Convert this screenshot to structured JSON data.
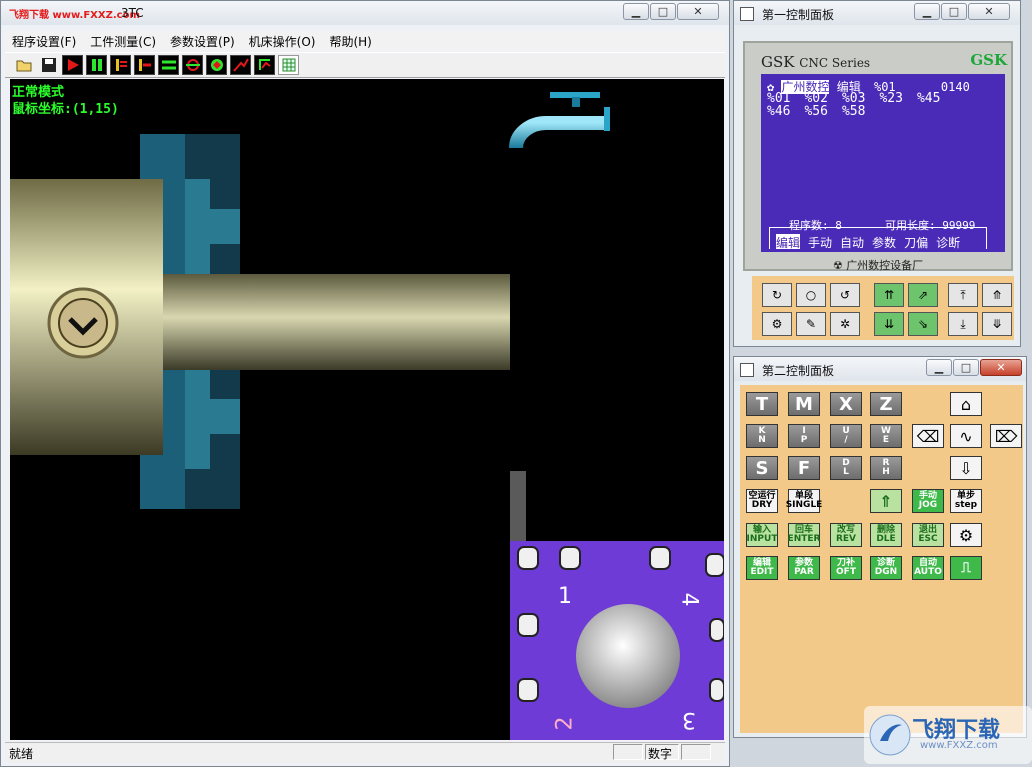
{
  "main_window": {
    "logo_text": "飞翔下载 www.FXXZ.com",
    "title_suffix": "3TC",
    "menu": [
      "程序设置(F)",
      "工件测量(C)",
      "参数设置(P)",
      "机床操作(O)",
      "帮助(H)"
    ],
    "toolbar_icons": [
      "open-icon",
      "save-icon",
      "play-icon",
      "pause-icon",
      "tool-icon",
      "pointer-icon",
      "line-icon",
      "circle-icon",
      "target-icon",
      "curve-icon",
      "graph-icon",
      "grid-icon"
    ],
    "overlay": {
      "mode": "正常模式",
      "mouse_coord": "鼠标坐标:(1,15)"
    },
    "turret_numbers": [
      "1",
      "4",
      "2",
      "3"
    ],
    "status": {
      "ready": "就绪",
      "numlock": "数字"
    }
  },
  "panel1": {
    "title": "第一控制面板",
    "brand": "GSK",
    "series": "CNC Series",
    "logo": "GSK",
    "lcd": {
      "header": [
        "广州数控",
        "编辑",
        "%01",
        "0140"
      ],
      "programs_row1": [
        "%01",
        "%02",
        "%03",
        "%23",
        "%45"
      ],
      "programs_row2": [
        "%46",
        "%56",
        "%58"
      ],
      "info_count": "程序数: 8",
      "info_length": "可用长度: 99999",
      "softkeys": [
        "编辑",
        "手动",
        "自动",
        "参数",
        "刀偏",
        "诊断"
      ]
    },
    "maker": "广州数控设备厂"
  },
  "panel2": {
    "title": "第二控制面板",
    "letter_row1": [
      "T",
      "M",
      "X",
      "Z"
    ],
    "letter_row2": [
      [
        "K",
        "N"
      ],
      [
        "I",
        "P"
      ],
      [
        "U",
        "/"
      ],
      [
        "W",
        "E"
      ]
    ],
    "letter_row3": [
      "S",
      "F",
      [
        "D",
        "L"
      ],
      [
        "R",
        "H"
      ]
    ],
    "func_row4": [
      [
        "空运行",
        "DRY"
      ],
      [
        "单段",
        "SINGLE"
      ],
      [
        "手动",
        "JOG"
      ],
      [
        "单步",
        "step"
      ]
    ],
    "func_row5": [
      [
        "输入",
        "INPUT"
      ],
      [
        "回车",
        "ENTER"
      ],
      [
        "改写",
        "REV"
      ],
      [
        "删除",
        "DLE"
      ],
      [
        "退出",
        "ESC"
      ]
    ],
    "func_row6": [
      [
        "编辑",
        "EDIT"
      ],
      [
        "参数",
        "PAR"
      ],
      [
        "刀补",
        "OFT"
      ],
      [
        "诊断",
        "DGN"
      ],
      [
        "自动",
        "AUTO"
      ]
    ]
  },
  "watermark": {
    "text": "飞翔下载",
    "url": "www.FXXZ.com"
  }
}
